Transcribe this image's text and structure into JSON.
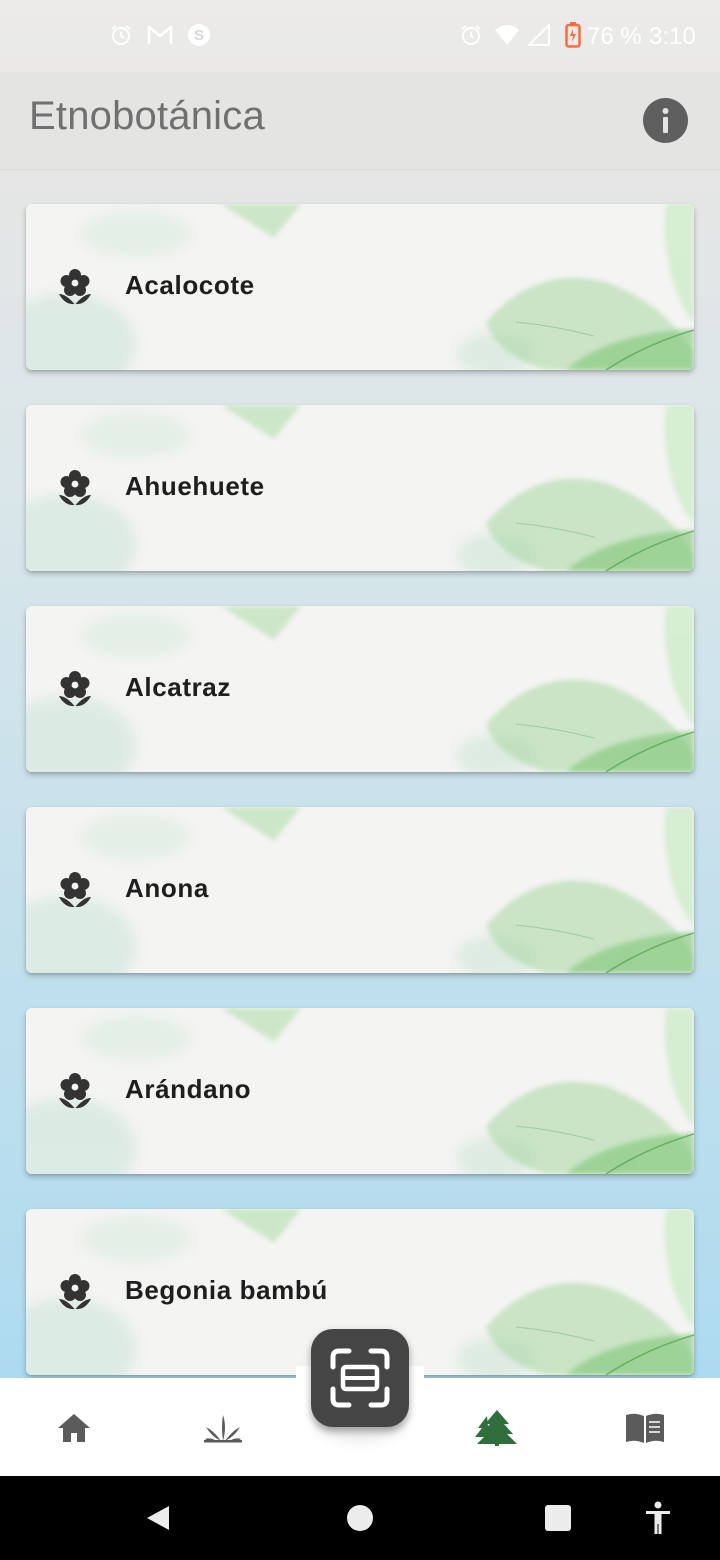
{
  "status_bar": {
    "battery_percent": "76 %",
    "time": "3:10",
    "left_icons": [
      "alarm-icon",
      "gmail-icon",
      "skype-icon"
    ],
    "right_icons": [
      "alarm-icon",
      "wifi-icon",
      "cell-signal-icon",
      "battery-charging-icon"
    ]
  },
  "app_bar": {
    "title": "Etnobotánica",
    "info_icon": "info-icon"
  },
  "plants": [
    {
      "name": "Acalocote",
      "icon": "flower-icon"
    },
    {
      "name": "Ahuehuete",
      "icon": "flower-icon"
    },
    {
      "name": "Alcatraz",
      "icon": "flower-icon"
    },
    {
      "name": "Anona",
      "icon": "flower-icon"
    },
    {
      "name": "Arándano",
      "icon": "flower-icon"
    },
    {
      "name": "Begonia bambú",
      "icon": "flower-icon"
    }
  ],
  "bottom_nav": {
    "items": [
      {
        "icon": "home-icon",
        "active": false
      },
      {
        "icon": "plant-sprout-icon",
        "active": false
      },
      {
        "icon": "scan-icon",
        "active": false
      },
      {
        "icon": "forest-icon",
        "active": true
      },
      {
        "icon": "book-icon",
        "active": false
      }
    ]
  },
  "system_nav": {
    "buttons": [
      "back-icon",
      "home-circle-icon",
      "recents-icon",
      "accessibility-icon"
    ]
  },
  "colors": {
    "nav_active": "#2e6f3c",
    "nav_inactive": "#5b5b5b",
    "title": "#707070",
    "scan_button": "#454545"
  }
}
